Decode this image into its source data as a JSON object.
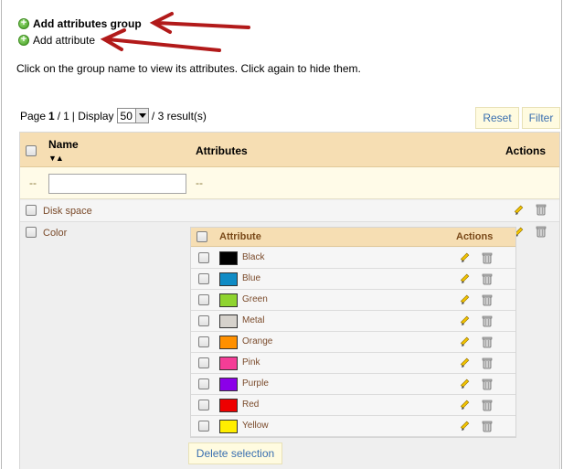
{
  "links": {
    "add_group": "Add attributes group",
    "add_attribute": "Add attribute"
  },
  "info": "Click on the group name to view its attributes. Click again to hide them.",
  "pager": {
    "page_label": "Page",
    "page": "1",
    "sep": "/",
    "total_pages": "1",
    "display_label": "| Display",
    "per_page": "50",
    "results": "/ 3 result(s)"
  },
  "buttons": {
    "reset": "Reset",
    "filter": "Filter",
    "delete_selection": "Delete selection"
  },
  "table": {
    "headers": {
      "name": "Name",
      "attributes": "Attributes",
      "actions": "Actions"
    },
    "filter_dash": "--",
    "groups": [
      "Disk space",
      "Color"
    ]
  },
  "inner_table": {
    "headers": {
      "attribute": "Attribute",
      "actions": "Actions"
    },
    "attributes": [
      {
        "name": "Black",
        "color": "#000000"
      },
      {
        "name": "Blue",
        "color": "#0f8bc5"
      },
      {
        "name": "Green",
        "color": "#8fd42f"
      },
      {
        "name": "Metal",
        "color": "#d6d2cc"
      },
      {
        "name": "Orange",
        "color": "#ff9000"
      },
      {
        "name": "Pink",
        "color": "#f43d96"
      },
      {
        "name": "Purple",
        "color": "#8b00e8"
      },
      {
        "name": "Red",
        "color": "#ee0000"
      },
      {
        "name": "Yellow",
        "color": "#ffee00"
      }
    ]
  },
  "colors": {
    "annotation_arrow": "#b21a1a",
    "header_bg": "#f6deb3",
    "link_brown": "#7a4a2a"
  }
}
